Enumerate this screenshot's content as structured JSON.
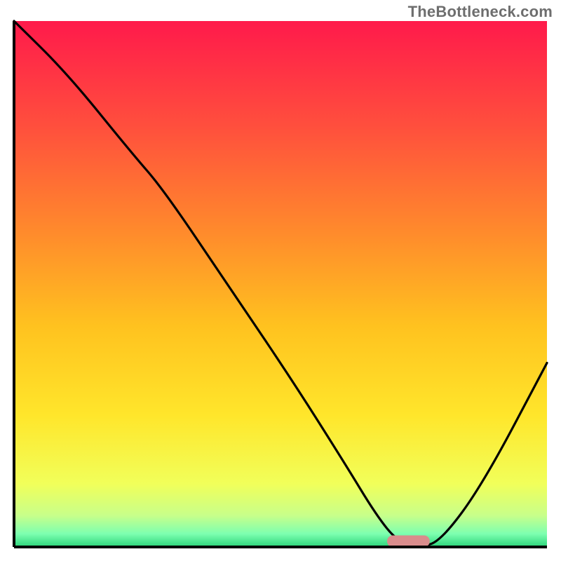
{
  "watermark": "TheBottleneck.com",
  "chart_data": {
    "type": "line",
    "title": "",
    "xlabel": "",
    "ylabel": "",
    "xlim": [
      0,
      100
    ],
    "ylim": [
      0,
      100
    ],
    "grid": false,
    "legend": false,
    "background_gradient": {
      "stops": [
        {
          "offset": 0.0,
          "color": "#ff1a4b"
        },
        {
          "offset": 0.2,
          "color": "#ff4f3d"
        },
        {
          "offset": 0.4,
          "color": "#ff8a2c"
        },
        {
          "offset": 0.58,
          "color": "#ffc21f"
        },
        {
          "offset": 0.75,
          "color": "#ffe62b"
        },
        {
          "offset": 0.88,
          "color": "#f1ff5a"
        },
        {
          "offset": 0.94,
          "color": "#c8ff8a"
        },
        {
          "offset": 0.975,
          "color": "#7dffb0"
        },
        {
          "offset": 1.0,
          "color": "#2bd47a"
        }
      ]
    },
    "series": [
      {
        "name": "bottleneck-curve",
        "color": "#000000",
        "x": [
          0,
          10,
          22,
          28,
          40,
          52,
          62,
          68,
          72,
          76,
          80,
          88,
          100
        ],
        "y": [
          100,
          90,
          75,
          68,
          50,
          32,
          16,
          6,
          1,
          0,
          1,
          12,
          35
        ]
      }
    ],
    "marker": {
      "name": "optimal-range-marker",
      "x_center": 74,
      "width": 8,
      "height": 2.2,
      "fill": "#d98c8c",
      "radius": 8
    },
    "axis_stroke": "#000000",
    "axis_stroke_width": 4
  }
}
